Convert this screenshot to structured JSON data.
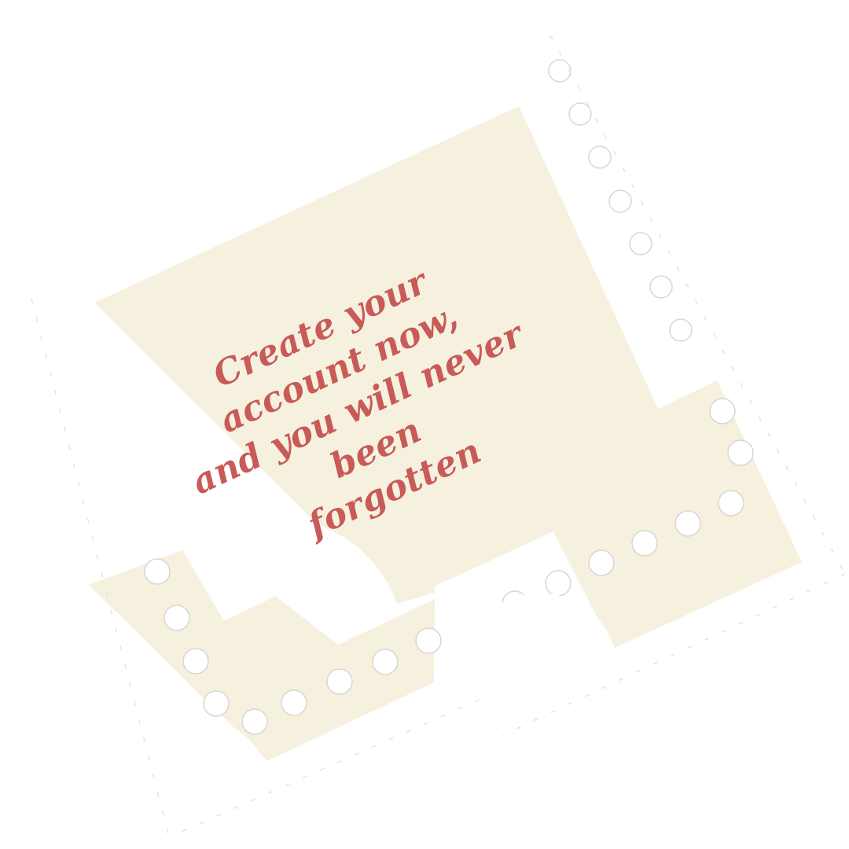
{
  "message": {
    "line1": "Create your account now,",
    "line2": "and you will never been",
    "line3": "forgotten"
  },
  "colors": {
    "background": "#ffffff",
    "stamp_paper": "#f6f1df",
    "stamp_border": "#ffffff",
    "perforation_edge": "#d8d6d0",
    "text": "#c85a58"
  },
  "decor": {
    "stamps": [
      "main-stamp",
      "bottom-left-stamp",
      "right-stamp"
    ]
  }
}
